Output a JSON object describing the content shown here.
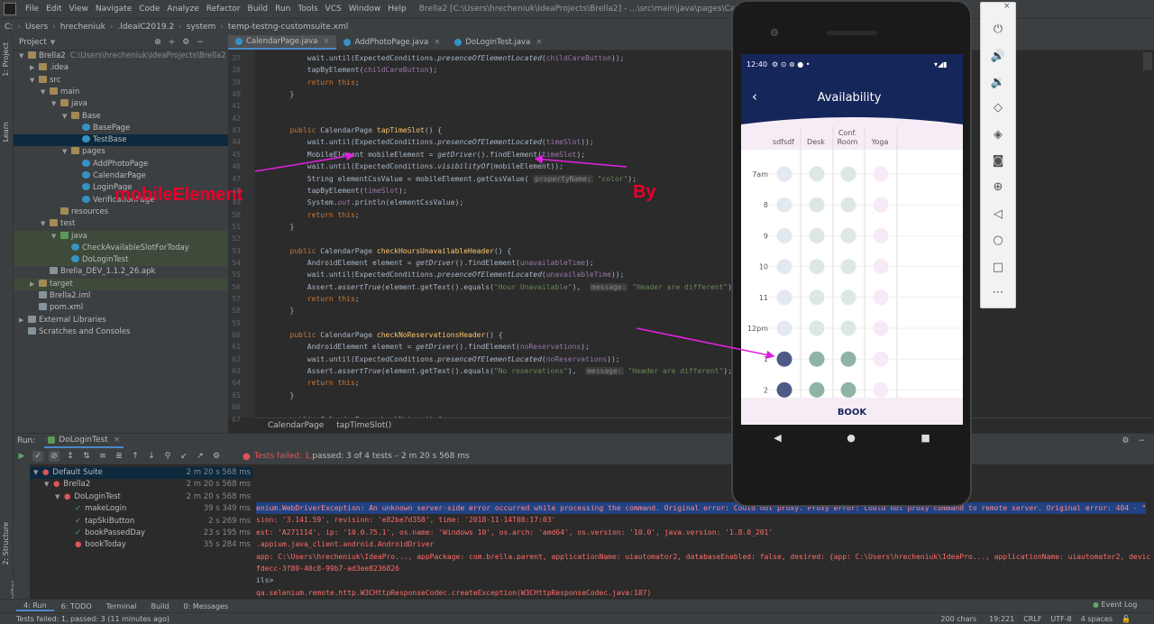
{
  "window": {
    "title": "Brella2 [C:\\Users\\hrecheniuk\\IdeaProjects\\Brella2] - ...\\src\\main\\java\\pages\\CalendarPage.java - IntelliJ IDEA",
    "menu": [
      "File",
      "Edit",
      "View",
      "Navigate",
      "Code",
      "Analyze",
      "Refactor",
      "Build",
      "Run",
      "Tools",
      "VCS",
      "Window",
      "Help"
    ]
  },
  "breadcrumbs": [
    "C:",
    "Users",
    "hrecheniuk",
    ".IdeaIC2019.2",
    "system",
    "temp-testng-customsuite.xml"
  ],
  "sidebar": {
    "project": "1: Project",
    "learn": "Learn",
    "structure": "2: Structure",
    "favorites": "2: Favorites"
  },
  "project": {
    "header": "Project",
    "tree": [
      {
        "label": "Brella2",
        "path": "C:\\Users\\hrecheniuk\\IdeaProjects\\Brella2",
        "indent": 0,
        "icon": "fold",
        "arrow": "▼"
      },
      {
        "label": ".idea",
        "indent": 1,
        "icon": "fold",
        "arrow": "▶"
      },
      {
        "label": "src",
        "indent": 1,
        "icon": "fold",
        "arrow": "▼"
      },
      {
        "label": "main",
        "indent": 2,
        "icon": "fold",
        "arrow": "▼"
      },
      {
        "label": "java",
        "indent": 3,
        "icon": "fold",
        "arrow": "▼"
      },
      {
        "label": "Base",
        "indent": 4,
        "icon": "fold",
        "arrow": "▼"
      },
      {
        "label": "BasePage",
        "indent": 5,
        "icon": "java",
        "arrow": ""
      },
      {
        "label": "TestBase",
        "indent": 5,
        "icon": "java",
        "arrow": "",
        "state": "sel"
      },
      {
        "label": "pages",
        "indent": 4,
        "icon": "fold",
        "arrow": "▼"
      },
      {
        "label": "AddPhotoPage",
        "indent": 5,
        "icon": "java",
        "arrow": ""
      },
      {
        "label": "CalendarPage",
        "indent": 5,
        "icon": "java",
        "arrow": ""
      },
      {
        "label": "LoginPage",
        "indent": 5,
        "icon": "java",
        "arrow": ""
      },
      {
        "label": "VerificationPage",
        "indent": 5,
        "icon": "java",
        "arrow": ""
      },
      {
        "label": "resources",
        "indent": 3,
        "icon": "fold",
        "arrow": ""
      },
      {
        "label": "test",
        "indent": 2,
        "icon": "fold",
        "arrow": "▼"
      },
      {
        "label": "java",
        "indent": 3,
        "icon": "test",
        "arrow": "▼",
        "state": "hl"
      },
      {
        "label": "CheckAvailableSlotForToday",
        "indent": 4,
        "icon": "java",
        "arrow": "",
        "state": "hl"
      },
      {
        "label": "DoLoginTest",
        "indent": 4,
        "icon": "java",
        "arrow": "",
        "state": "hl"
      },
      {
        "label": "Brella_DEV_1.1.2_26.apk",
        "indent": 2,
        "icon": "file",
        "arrow": ""
      },
      {
        "label": "target",
        "indent": 1,
        "icon": "fold",
        "arrow": "▶",
        "state": "hl"
      },
      {
        "label": "Brella2.iml",
        "indent": 1,
        "icon": "file",
        "arrow": ""
      },
      {
        "label": "pom.xml",
        "indent": 1,
        "icon": "file",
        "arrow": ""
      },
      {
        "label": "External Libraries",
        "indent": 0,
        "icon": "file",
        "arrow": "▶"
      },
      {
        "label": "Scratches and Consoles",
        "indent": 0,
        "icon": "file",
        "arrow": ""
      }
    ]
  },
  "tabs": [
    {
      "label": "CalendarPage.java",
      "active": true
    },
    {
      "label": "AddPhotoPage.java",
      "active": false
    },
    {
      "label": "DoLoginTest.java",
      "active": false
    }
  ],
  "code": {
    "lines": [
      {
        "n": "37",
        "html": "            wait.until(ExpectedConditions.<span class='i'>presenceOfElementLocated</span>(<span class='f'>childCareButton</span>));"
      },
      {
        "n": "38",
        "html": "            tapByElement(<span class='f'>childCareButton</span>);"
      },
      {
        "n": "39",
        "html": "            <span class='k'>return this</span>;"
      },
      {
        "n": "40",
        "html": "        }"
      },
      {
        "n": "41",
        "html": ""
      },
      {
        "n": "42",
        "html": ""
      },
      {
        "n": "43",
        "html": "        <span class='k'>public</span> CalendarPage <span class='m'>tapTimeSlot</span>() {"
      },
      {
        "n": "44",
        "html": "            wait.until(ExpectedConditions.<span class='i'>presenceOfElementLocated</span>(<span class='f'>timeSlot</span>));"
      },
      {
        "n": "45",
        "html": "            MobileElement mobileElement = <span class='i'>getDriver</span>().findElement(<span class='f'>timeSlot</span>);"
      },
      {
        "n": "46",
        "html": "            wait.until(ExpectedConditions.<span class='i'>visibilityOf</span>(mobileElement));"
      },
      {
        "n": "47",
        "html": "            String elementCssValue = mobileElement.getCssValue( <span class='h'>propertyName:</span> <span class='s'>\"color\"</span>);"
      },
      {
        "n": "48",
        "html": "            tapByElement(<span class='f'>timeSlot</span>);"
      },
      {
        "n": "49",
        "html": "            System.<span class='f i'>out</span>.println(elementCssValue);"
      },
      {
        "n": "50",
        "html": "            <span class='k'>return this</span>;"
      },
      {
        "n": "51",
        "html": "        }"
      },
      {
        "n": "52",
        "html": ""
      },
      {
        "n": "53",
        "html": "        <span class='k'>public</span> CalendarPage <span class='m'>checkHoursUnavailableHeader</span>() {"
      },
      {
        "n": "54",
        "html": "            AndroidElement element = <span class='i'>getDriver</span>().findElement(<span class='f'>unavailableTime</span>);"
      },
      {
        "n": "55",
        "html": "            wait.until(ExpectedConditions.<span class='i'>presenceOfElementLocated</span>(<span class='f'>unavailableTime</span>));"
      },
      {
        "n": "56",
        "html": "            Assert.<span class='i'>assertTrue</span>(element.getText().equals(<span class='s'>\"Hour Unavailable\"</span>),  <span class='h'>message:</span> <span class='s'>\"Header are different\"</span>);"
      },
      {
        "n": "57",
        "html": "            <span class='k'>return this</span>;"
      },
      {
        "n": "58",
        "html": "        }"
      },
      {
        "n": "59",
        "html": ""
      },
      {
        "n": "60",
        "html": "        <span class='k'>public</span> CalendarPage <span class='m'>checkNoReservationsHeader</span>() {"
      },
      {
        "n": "61",
        "html": "            AndroidElement element = <span class='i'>getDriver</span>().findElement(<span class='f'>noReservations</span>);"
      },
      {
        "n": "62",
        "html": "            wait.until(ExpectedConditions.<span class='i'>presenceOfElementLocated</span>(<span class='f'>noReservations</span>));"
      },
      {
        "n": "63",
        "html": "            Assert.<span class='i'>assertTrue</span>(element.getText().equals(<span class='s'>\"No reservations\"</span>),  <span class='h'>message:</span> <span class='s'>\"Header are different\"</span>);"
      },
      {
        "n": "64",
        "html": "            <span class='k'>return this</span>;"
      },
      {
        "n": "65",
        "html": "        }"
      },
      {
        "n": "66",
        "html": ""
      },
      {
        "n": "67",
        "html": "        <span class='k'>public</span> CalendarPage checkNot...() {"
      }
    ],
    "breadcrumb": [
      "CalendarPage",
      "tapTimeSlot()"
    ]
  },
  "annotations": {
    "mobileElement": "mobileElement",
    "by": "By"
  },
  "run": {
    "label": "Run:",
    "config": "DoLoginTest",
    "status_prefix": "Tests failed: 1,",
    "status_rest": " passed: 3 of 4 tests – 2 m 20 s 568 ms",
    "tree": [
      {
        "label": "Default Suite",
        "time": "2 m 20 s 568 ms",
        "indent": 0,
        "status": "fail",
        "sel": true
      },
      {
        "label": "Brella2",
        "time": "2 m 20 s 568 ms",
        "indent": 1,
        "status": "fail"
      },
      {
        "label": "DoLoginTest",
        "time": "2 m 20 s 568 ms",
        "indent": 2,
        "status": "fail"
      },
      {
        "label": "makeLogin",
        "time": "39 s 349 ms",
        "indent": 3,
        "status": "pass"
      },
      {
        "label": "tapSkiButton",
        "time": "2 s 269 ms",
        "indent": 3,
        "status": "pass"
      },
      {
        "label": "bookPassedDay",
        "time": "23 s 195 ms",
        "indent": 3,
        "status": "pass"
      },
      {
        "label": "bookToday",
        "time": "35 s 284 ms",
        "indent": 3,
        "status": "fail"
      }
    ]
  },
  "console": {
    "lines": [
      "enium.WebDriverException: An unknown server-side error occurred while processing the command. Original error: Could not proxy. Proxy error: Could not proxy command to remote server. Original error: 404 - \"",
      "sion: '3.141.59', revision: 'e82be7d358', time: '2018-11-14T08:17:03'",
      "est: 'A271114', ip: '10.0.75.1', os.name: 'Windows 10', os.arch: 'amd64', os.version: '10.0', java.version: '1.8.0_201'",
      ".appium.java_client.android.AndroidDriver",
      "app: C:\\Users\\hrecheniuk\\IdeaPro..., appPackage: com.brella.parent, applicationName: uiautomator2, databaseEnabled: false, desired: {app: C:\\Users\\hrecheniuk\\IdeaPro..., applicationName: uiautomator2, devic",
      "fdecc-3f80-40c8-99b7-ad3ee8236826",
      "ils>",
      "qa.selenium.remote.http.W3CHttpResponseCodec.createException(W3CHttpResponseCodec.java:187)"
    ]
  },
  "bottom_tabs": [
    "4: Run",
    "6: TODO",
    "Terminal",
    "Build",
    "0: Messages"
  ],
  "event_log": "Event Log",
  "status": {
    "left": "Tests failed: 1, passed: 3 (11 minutes ago)",
    "chars": "200 chars",
    "pos": "19:221",
    "crlf": "CRLF",
    "enc": "UTF-8",
    "indent": "4 spaces"
  },
  "phone": {
    "time": "12:40",
    "title": "Availability",
    "columns": [
      "sdfsdf",
      "Desk",
      "Conf. Room",
      "Yoga"
    ],
    "rows": [
      "7am",
      "8",
      "9",
      "10",
      "11",
      "12pm",
      "1",
      "2"
    ],
    "book": "BOOK"
  },
  "colors": {
    "accent": "#4a88c7",
    "annotation": "#e8002a",
    "arrow": "#e020e0",
    "phone_header": "#15265a",
    "pink": "#f6ecf6"
  }
}
